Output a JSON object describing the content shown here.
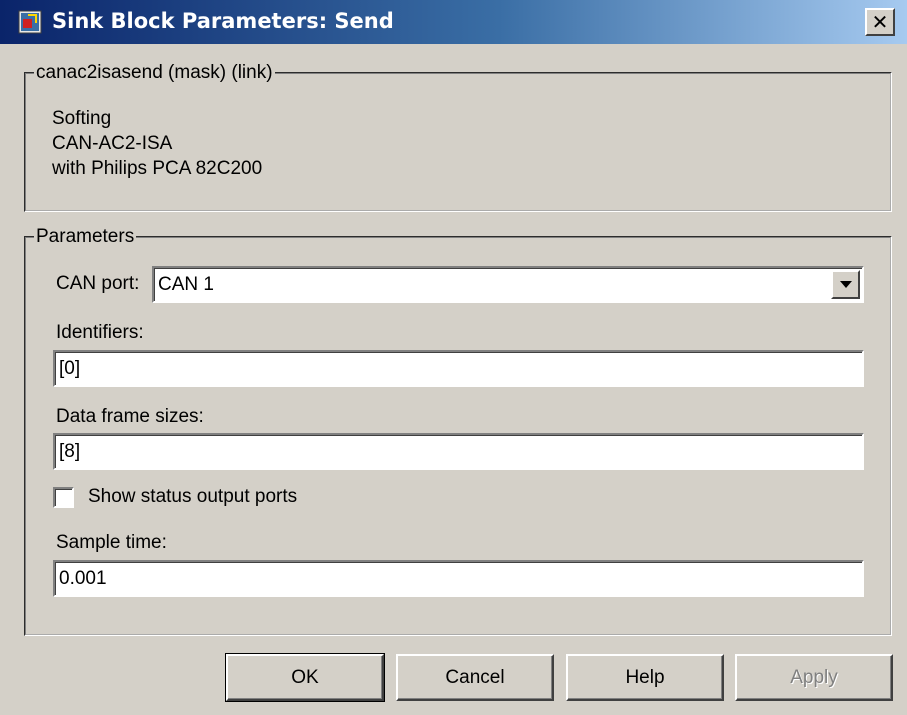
{
  "window": {
    "title": "Sink Block Parameters: Send",
    "close_label": "✕"
  },
  "mask": {
    "legend": "canac2isasend (mask) (link)",
    "description": [
      "Softing",
      "CAN-AC2-ISA",
      "with Philips PCA 82C200"
    ]
  },
  "parameters": {
    "legend": "Parameters",
    "can_port_label": "CAN port:",
    "can_port_value": "CAN 1",
    "identifiers_label": "Identifiers:",
    "identifiers_value": "[0]",
    "frame_sizes_label": "Data frame sizes:",
    "frame_sizes_value": "[8]",
    "show_status_label": "Show status output ports",
    "show_status_checked": false,
    "sample_time_label": "Sample time:",
    "sample_time_value": "0.001"
  },
  "buttons": {
    "ok": "OK",
    "cancel": "Cancel",
    "help": "Help",
    "apply": "Apply"
  },
  "colors": {
    "title_start": "#0a246a",
    "title_end": "#a6caf0",
    "face": "#d4d0c8"
  }
}
